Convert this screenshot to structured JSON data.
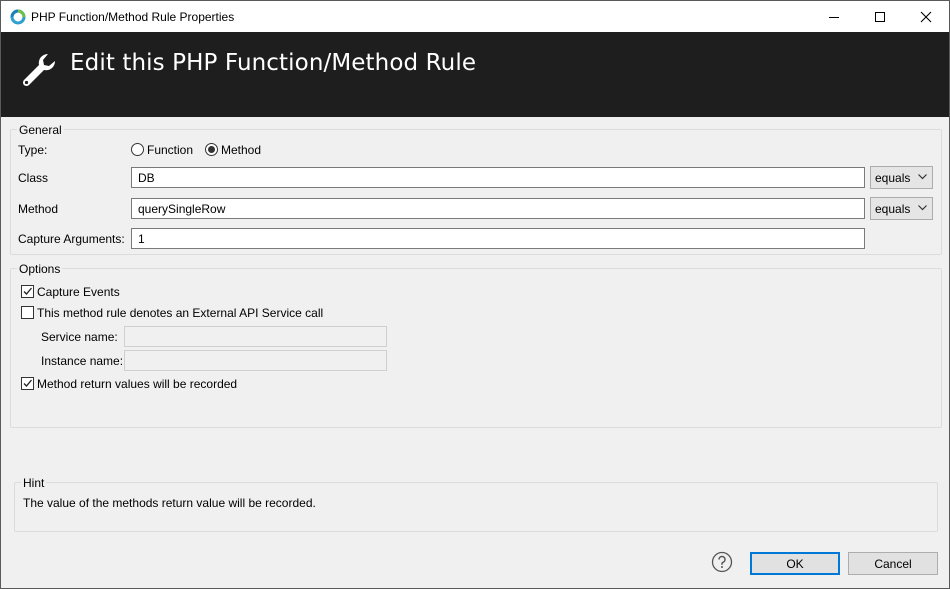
{
  "window": {
    "title": "PHP Function/Method Rule Properties"
  },
  "banner": {
    "title": "Edit this PHP Function/Method Rule"
  },
  "general": {
    "legend": "General",
    "type_label": "Type:",
    "type_options": [
      "Function",
      "Method"
    ],
    "type_selected": "Method",
    "class_label": "Class",
    "class_value": "DB",
    "class_match": "equals",
    "method_label": "Method",
    "method_value": "querySingleRow",
    "method_match": "equals",
    "capture_args_label": "Capture Arguments:",
    "capture_args_value": "1"
  },
  "options": {
    "legend": "Options",
    "capture_events_label": "Capture Events",
    "capture_events_checked": true,
    "external_api_label": "This method rule denotes an External API Service call",
    "external_api_checked": false,
    "service_name_label": "Service name:",
    "service_name_value": "",
    "instance_name_label": "Instance name:",
    "instance_name_value": "",
    "return_values_label": "Method return values will be recorded",
    "return_values_checked": true
  },
  "hint": {
    "legend": "Hint",
    "text": "The value of the methods return value will be recorded."
  },
  "footer": {
    "ok_label": "OK",
    "cancel_label": "Cancel"
  },
  "icons": {
    "app": "app-logo-icon",
    "banner": "wrench-icon",
    "help": "help-icon"
  },
  "colors": {
    "banner_bg": "#1e1e1e",
    "accent": "#0078d7"
  }
}
